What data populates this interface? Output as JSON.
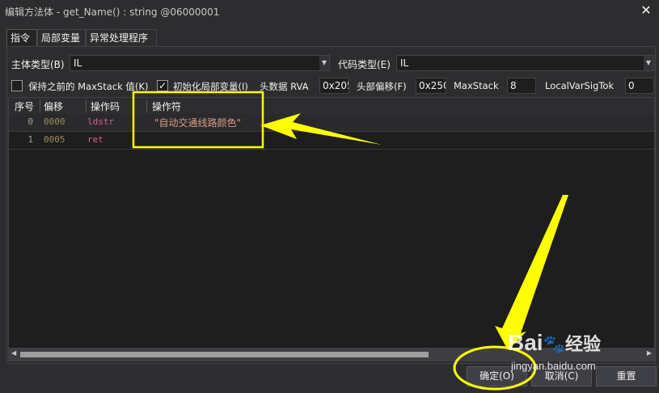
{
  "window": {
    "title": "编辑方法体 - get_Name() : string @06000001",
    "close_icon": "close-icon"
  },
  "tabs": [
    {
      "label": "指令",
      "active": true
    },
    {
      "label": "局部变量",
      "active": false
    },
    {
      "label": "异常处理程序",
      "active": false
    }
  ],
  "body_type": {
    "label": "主体类型(B)",
    "value": "IL"
  },
  "code_type": {
    "label": "代码类型(E)",
    "value": "IL"
  },
  "options": {
    "keep_maxstack_label": "保持之前的 MaxStack 值(K)",
    "keep_maxstack_checked": false,
    "init_locals_label": "初始化局部变量(I)",
    "init_locals_checked": true,
    "header_rva_label": "头数据 RVA",
    "header_rva_value": "0x205",
    "header_offset_label": "头部偏移(F)",
    "header_offset_value": "0x250",
    "maxstack_label": "MaxStack",
    "maxstack_value": "8",
    "localvarsigtok_label": "LocalVarSigTok",
    "localvarsigtok_value": "0"
  },
  "grid": {
    "columns": [
      "序号",
      "偏移",
      "操作码",
      "操作符"
    ],
    "rows": [
      {
        "index": "0",
        "offset": "0000",
        "opcode": "ldstr",
        "operand": "\"自动交通线路颜色\""
      },
      {
        "index": "1",
        "offset": "0005",
        "opcode": "ret",
        "operand": ""
      }
    ]
  },
  "buttons": {
    "ok": "确定(O)",
    "cancel": "取消(C)",
    "reset": "重置"
  },
  "watermark": {
    "brand": "Bai",
    "brand_suffix": "经验",
    "url": "jingyan.baidu.com"
  },
  "colors": {
    "annotation": "#ffff00",
    "background": "#2d2d30",
    "grid_bg": "#1e1e1e"
  }
}
